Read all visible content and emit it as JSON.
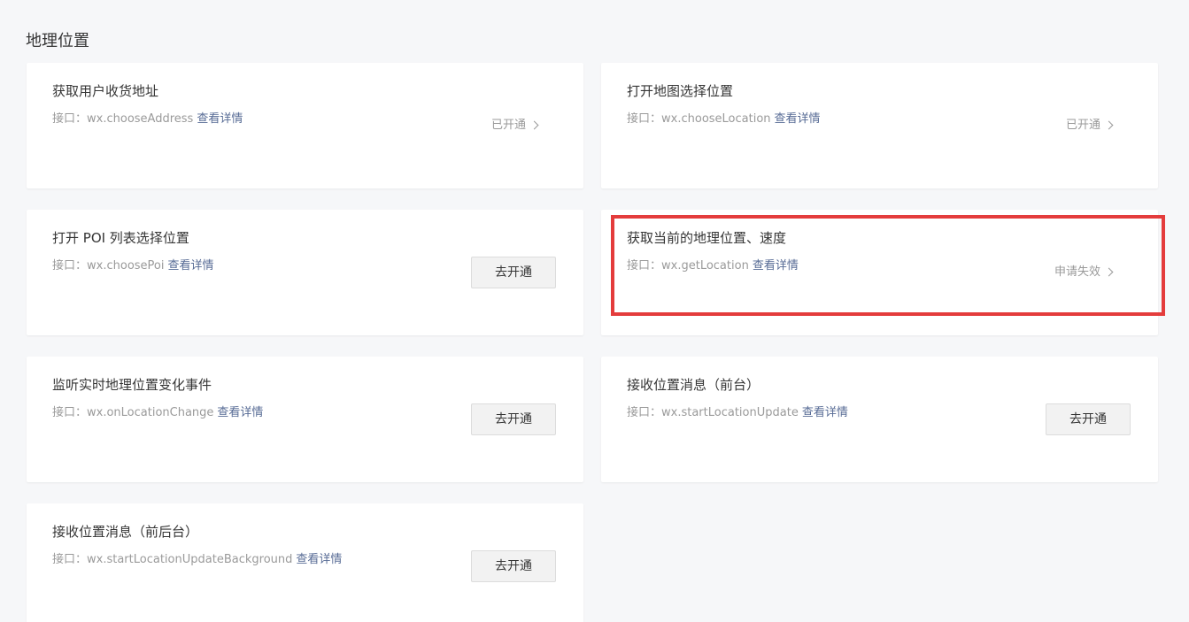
{
  "section": {
    "title": "地理位置"
  },
  "cards": [
    {
      "title": "获取用户收货地址",
      "api_prefix": "接口：",
      "api_name": "wx.chooseAddress",
      "detail_link": "查看详情",
      "status": "已开通"
    },
    {
      "title": "打开地图选择位置",
      "api_prefix": "接口：",
      "api_name": "wx.chooseLocation",
      "detail_link": "查看详情",
      "status": "已开通"
    },
    {
      "title": "打开 POI 列表选择位置",
      "api_prefix": "接口：",
      "api_name": "wx.choosePoi",
      "detail_link": "查看详情",
      "button": "去开通"
    },
    {
      "title": "获取当前的地理位置、速度",
      "api_prefix": "接口：",
      "api_name": "wx.getLocation",
      "detail_link": "查看详情",
      "status": "申请失效"
    },
    {
      "title": "监听实时地理位置变化事件",
      "api_prefix": "接口：",
      "api_name": "wx.onLocationChange",
      "detail_link": "查看详情",
      "button": "去开通"
    },
    {
      "title": "接收位置消息（前台）",
      "api_prefix": "接口：",
      "api_name": "wx.startLocationUpdate",
      "detail_link": "查看详情",
      "button": "去开通"
    },
    {
      "title": "接收位置消息（前后台）",
      "api_prefix": "接口：",
      "api_name": "wx.startLocationUpdateBackground",
      "detail_link": "查看详情",
      "button": "去开通"
    }
  ],
  "colors": {
    "highlight": "#e43c3c",
    "link": "#576b95",
    "muted": "#9a9a9a"
  }
}
